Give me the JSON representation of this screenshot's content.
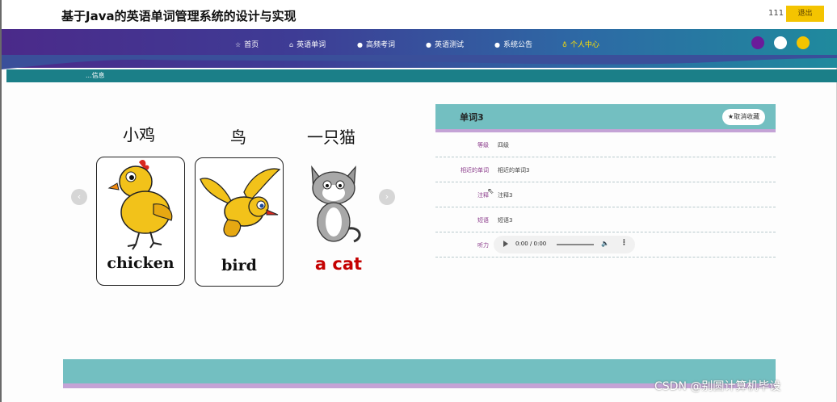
{
  "header": {
    "title": "基于Java的英语单词管理系统的设计与实现",
    "username": "111",
    "logout_label": "退出"
  },
  "nav": {
    "items": [
      {
        "label": "首页",
        "icon": "star-icon"
      },
      {
        "label": "英语单词",
        "icon": "home-icon"
      },
      {
        "label": "高频考词",
        "icon": "circle-icon"
      },
      {
        "label": "英语测试",
        "icon": "circle-icon"
      },
      {
        "label": "系统公告",
        "icon": "circle-icon"
      },
      {
        "label": "个人中心",
        "icon": "user-icon"
      }
    ],
    "theme_dots": [
      "#6a1b9a",
      "#ffffff",
      "#f4c400"
    ]
  },
  "breadcrumb": {
    "label": "...信息"
  },
  "carousel": {
    "cards": [
      {
        "caption": "小鸡",
        "word": "chicken",
        "word_color": "#111111"
      },
      {
        "caption": "鸟",
        "word": "bird",
        "word_color": "#111111"
      },
      {
        "caption": "一只猫",
        "word": "a cat",
        "word_color": "#c40000"
      }
    ]
  },
  "detail": {
    "title": "单词3",
    "unfavorite_label": "取消收藏",
    "rows": [
      {
        "label": "等级",
        "value": "四级"
      },
      {
        "label": "相近的单词",
        "value": "相近的单词3"
      },
      {
        "label": "注释",
        "value": "注释3"
      },
      {
        "label": "短语",
        "value": "短语3"
      }
    ],
    "audio": {
      "label": "听力",
      "time": "0:00 / 0:00"
    }
  },
  "watermark": "CSDN @别圆计算机毕设"
}
